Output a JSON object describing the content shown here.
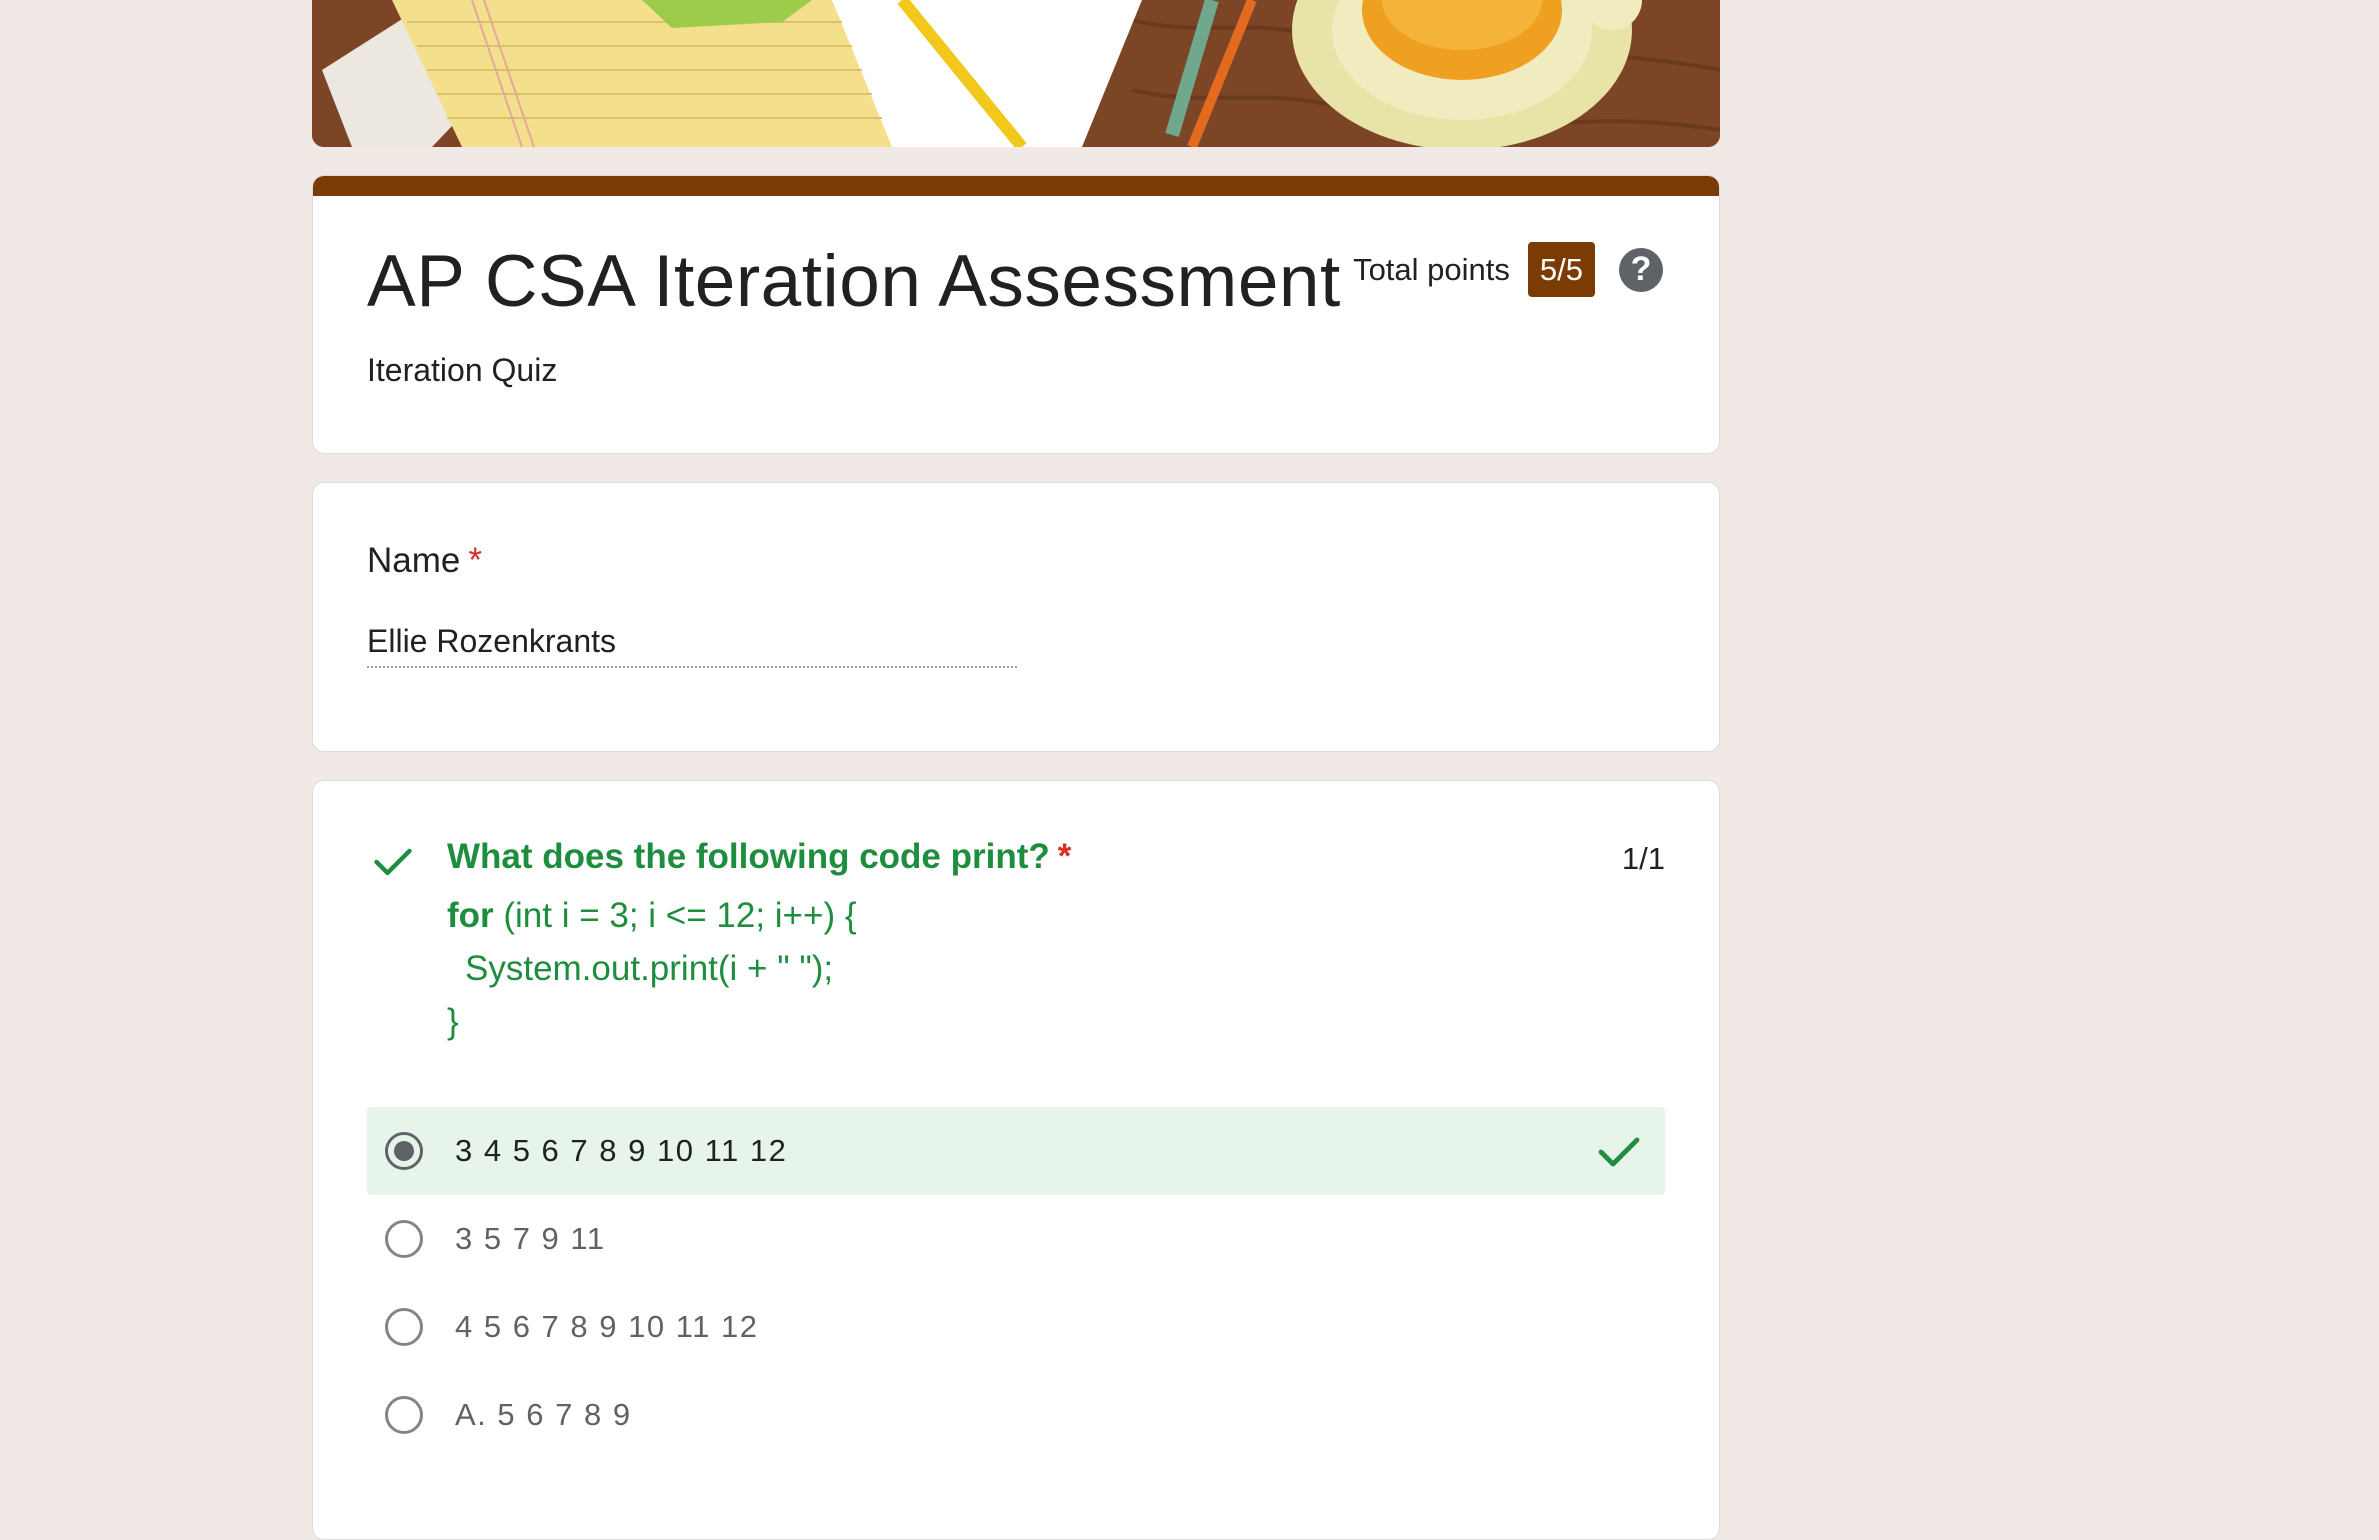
{
  "form": {
    "title": "AP CSA Iteration Assessment",
    "description": "Iteration Quiz",
    "total_points_label": "Total points",
    "total_points_value": "5/5",
    "help_glyph": "?"
  },
  "name_question": {
    "label": "Name",
    "required_mark": "*",
    "answer": "Ellie Rozenkrants"
  },
  "question1": {
    "title": "What does the following code print?",
    "required_mark": "*",
    "score": "1/1",
    "code": {
      "line1_keyword": "for",
      "line1_rest": " (int i = 3; i <= 12; i++) {",
      "line2": "System.out.print(i + \" \");",
      "line3": "}"
    },
    "options": [
      {
        "label": "3 4 5 6 7 8 9 10 11 12",
        "selected": true,
        "correct": true
      },
      {
        "label": "3 5 7 9 11",
        "selected": false,
        "correct": false
      },
      {
        "label": "4 5 6 7 8 9 10 11 12",
        "selected": false,
        "correct": false
      },
      {
        "label": "A. 5 6 7 8 9",
        "selected": false,
        "correct": false
      }
    ]
  },
  "colors": {
    "theme": "#7a3b05",
    "correct_green": "#1e8e3e",
    "correct_bg": "#e6f4ea",
    "required_red": "#d93025",
    "page_bg": "#f1e9e5"
  },
  "icons": {
    "correct": "check-icon",
    "help": "help-circle-icon",
    "banner": "desk-illustration"
  }
}
